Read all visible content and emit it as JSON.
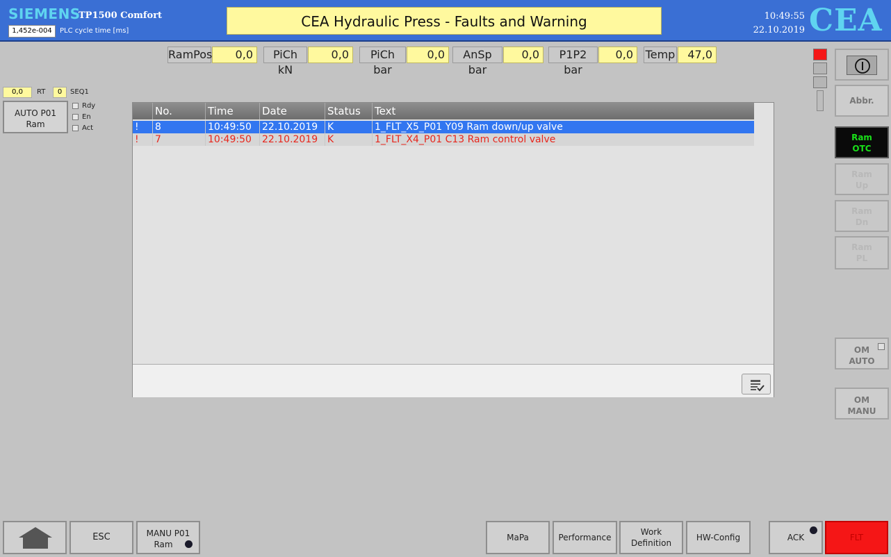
{
  "header": {
    "brand": "SIEMENS",
    "model": "TP1500 Comfort",
    "cycle_value": "1,452e-004",
    "cycle_label": "PLC cycle time [ms]",
    "title": "CEA Hydraulic Press - Faults and Warning",
    "time": "10:49:55",
    "date": "22.10.2019",
    "logo": "CEA"
  },
  "sensors": [
    {
      "label": "RamPos",
      "value": "0,0"
    },
    {
      "label": "PiCh kN",
      "value": "0,0"
    },
    {
      "label": "PiCh bar",
      "value": "0,0"
    },
    {
      "label": "AnSp bar",
      "value": "0,0"
    },
    {
      "label": "P1P2 bar",
      "value": "0,0"
    },
    {
      "label": "Temp",
      "value": "47,0"
    }
  ],
  "left_panel": {
    "rt_value": "0,0",
    "rt_label": "RT",
    "seq_value": "0",
    "seq_label": "SEQ1",
    "auto_button_line1": "AUTO P01",
    "auto_button_line2": "Ram",
    "checks": [
      "Rdy",
      "En",
      "Act"
    ]
  },
  "alarm_table": {
    "columns": [
      "No.",
      "Time",
      "Date",
      "Status",
      "Text"
    ],
    "rows": [
      {
        "mark": "!",
        "no": "8",
        "time": "10:49:50",
        "date": "22.10.2019",
        "status": "K",
        "text": "1_FLT_X5_P01 Y09 Ram down/up valve"
      },
      {
        "mark": "!",
        "no": "7",
        "time": "10:49:50",
        "date": "22.10.2019",
        "status": "K",
        "text": "1_FLT_X4_P01 C13 Ram control valve"
      }
    ],
    "selected_row_color": "#3276f0",
    "fault_text_color": "#e8261c"
  },
  "right_panel": {
    "abbr": "Abbr.",
    "ram_otc": [
      "Ram",
      "OTC"
    ],
    "ram_up": [
      "Ram",
      "Up"
    ],
    "ram_dn": [
      "Ram",
      "Dn"
    ],
    "ram_pl": [
      "Ram",
      "PL"
    ],
    "om_auto": [
      "OM",
      "AUTO"
    ],
    "om_manu": [
      "OM",
      "MANU"
    ]
  },
  "bottom_bar": {
    "esc": "ESC",
    "manu_line1": "MANU P01",
    "manu_line2": "Ram",
    "mapa": "MaPa",
    "performance": "Performance",
    "work_line1": "Work",
    "work_line2": "Definition",
    "hw_config": "HW-Config",
    "ack": "ACK",
    "flt": "FLT"
  },
  "colors": {
    "header_blue": "#3a6fd4",
    "active_green": "#19e019",
    "fault_red": "#f51616"
  }
}
